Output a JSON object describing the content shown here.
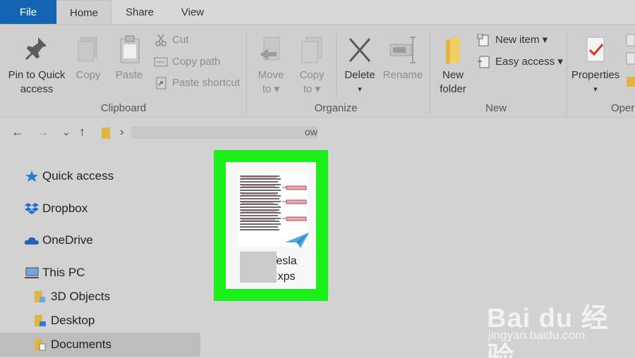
{
  "tabs": {
    "file": "File",
    "home": "Home",
    "share": "Share",
    "view": "View"
  },
  "clipboard": {
    "pin_line1": "Pin to Quick",
    "pin_line2": "access",
    "copy": "Copy",
    "paste": "Paste",
    "cut": "Cut",
    "copy_path": "Copy path",
    "paste_shortcut": "Paste shortcut",
    "label": "Clipboard"
  },
  "organize": {
    "move_to_line1": "Move",
    "move_to_line2": "to ▾",
    "copy_to_line1": "Copy",
    "copy_to_line2": "to ▾",
    "delete": "Delete",
    "delete_arrow": "▾",
    "rename": "Rename",
    "label": "Organize"
  },
  "new": {
    "new_folder_line1": "New",
    "new_folder_line2": "folder",
    "new_item": "New item ▾",
    "easy_access": "Easy access ▾",
    "label": "New"
  },
  "open": {
    "properties": "Properties",
    "properties_arrow": "▾",
    "label": "Oper"
  },
  "address": {
    "back": "←",
    "forward": "→",
    "recent": "⌄",
    "up": "↑",
    "separator": "›",
    "path_tail": "ow"
  },
  "sidebar": {
    "items": [
      {
        "label": "Quick access"
      },
      {
        "label": "Dropbox"
      },
      {
        "label": "OneDrive"
      },
      {
        "label": "This PC"
      },
      {
        "label": "3D Objects"
      },
      {
        "label": "Desktop"
      },
      {
        "label": "Documents"
      }
    ]
  },
  "file": {
    "name_line1": "Tesla",
    "name_line2": "B        phy.xps"
  },
  "watermark": {
    "main": "Bai du 经验",
    "sub": "jingyan.baidu.com"
  },
  "colors": {
    "accent": "#1565b5",
    "selection": "#1bf01b",
    "ribbon": "#cfcfcf"
  }
}
